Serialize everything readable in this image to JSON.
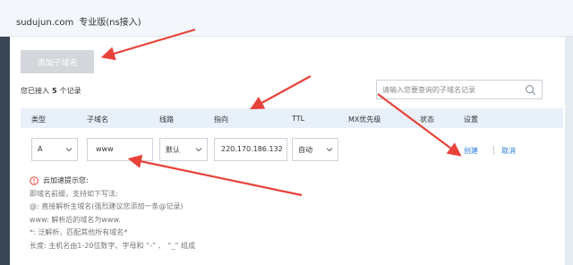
{
  "header": {
    "domain": "sudujun.com",
    "edition": "专业版(ns接入)"
  },
  "toolbar": {
    "add_subdomain_label": "添加子域名"
  },
  "records": {
    "prefix": "您已接入",
    "count": "5",
    "suffix": "个记录"
  },
  "search": {
    "placeholder": "请输入您要查询的子域名记录"
  },
  "table": {
    "headers": [
      "类型",
      "子域名",
      "线路",
      "指向",
      "TTL",
      "MX优先级",
      "状态",
      "设置"
    ]
  },
  "edit_row": {
    "type": "A",
    "subdomain": "www",
    "line": "默认",
    "target": "220.170.186.132",
    "ttl": "自动",
    "create_label": "创建",
    "cancel_label": "取消"
  },
  "tips": {
    "title": "云加速提示您:",
    "lines": [
      "即域名前缀，支持如下写法:",
      "@:   直接解析主域名(强烈建议您添加一条@记录)",
      "www:   解析后的域名为www.",
      "*:   泛解析，匹配其他所有域名*",
      "长度:   主机名由1-20位数字、字母和 “-”  、 “_” 组成"
    ]
  },
  "colors": {
    "accent": "#2b7ddb",
    "arrow": "#e8433a",
    "sidebar": "#3a4556",
    "table_header": "#e8f0f9"
  },
  "icons": {
    "search": "search-icon",
    "warning": "warning-icon",
    "caret": "chevron-down-icon"
  }
}
